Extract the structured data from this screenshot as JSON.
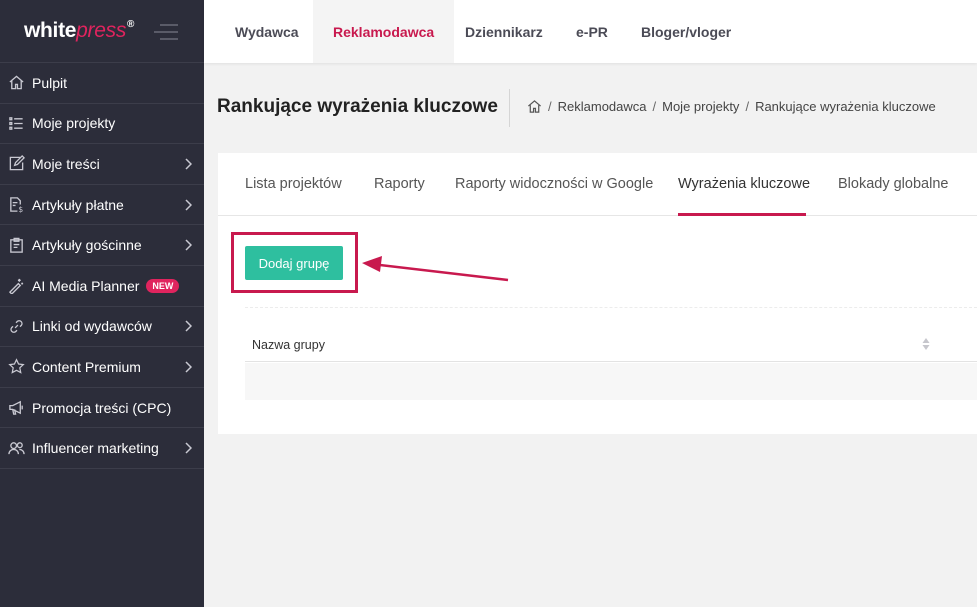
{
  "brand": {
    "name_white": "white",
    "name_press": "press",
    "registered": "®"
  },
  "sidebar": {
    "items": [
      {
        "label": "Pulpit",
        "icon": "home-icon",
        "chevron": false
      },
      {
        "label": "Moje projekty",
        "icon": "list-icon",
        "chevron": false
      },
      {
        "label": "Moje treści",
        "icon": "edit-icon",
        "chevron": true
      },
      {
        "label": "Artykuły płatne",
        "icon": "paid-article-icon",
        "chevron": true
      },
      {
        "label": "Artykuły gościnne",
        "icon": "clipboard-icon",
        "chevron": true
      },
      {
        "label": "AI Media Planner",
        "icon": "magic-wand-icon",
        "chevron": false,
        "badge": "NEW"
      },
      {
        "label": "Linki od wydawców",
        "icon": "link-icon",
        "chevron": true
      },
      {
        "label": "Content Premium",
        "icon": "star-icon",
        "chevron": true
      },
      {
        "label": "Promocja treści (CPC)",
        "icon": "megaphone-icon",
        "chevron": false
      },
      {
        "label": "Influencer marketing",
        "icon": "users-icon",
        "chevron": true
      }
    ]
  },
  "topnav": {
    "tabs": [
      {
        "label": "Wydawca"
      },
      {
        "label": "Reklamodawca",
        "active": true
      },
      {
        "label": "Dziennikarz"
      },
      {
        "label": "e-PR"
      },
      {
        "label": "Bloger/vloger"
      }
    ]
  },
  "page": {
    "title": "Rankujące wyrażenia kluczowe",
    "breadcrumb": [
      "Reklamodawca",
      "Moje projekty",
      "Rankujące wyrażenia kluczowe"
    ]
  },
  "tabs": [
    {
      "label": "Lista projektów"
    },
    {
      "label": "Raporty"
    },
    {
      "label": "Raporty widoczności w Google"
    },
    {
      "label": "Wyrażenia kluczowe",
      "active": true
    },
    {
      "label": "Blokady globalne"
    }
  ],
  "actions": {
    "add_group": "Dodaj grupę"
  },
  "table": {
    "column_name": "Nazwa grupy"
  },
  "colors": {
    "sidebar_bg": "#2c2d3a",
    "accent": "#c8194e",
    "primary_button": "#2ebf9f"
  }
}
